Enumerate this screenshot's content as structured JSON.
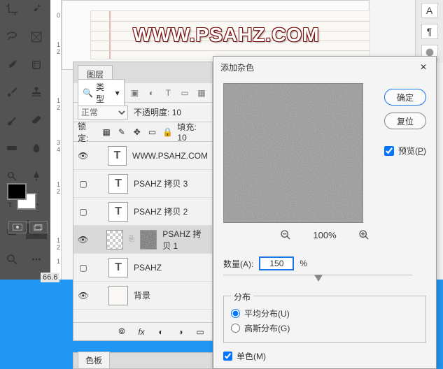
{
  "sidebar_icons": [
    "text-icon",
    "paragraph-icon",
    "3d-icon"
  ],
  "ruler_ticks": [
    "0",
    "1",
    "2",
    "1",
    "2",
    "3",
    "4",
    "1",
    "2",
    "1",
    "2",
    "1"
  ],
  "canvas": {
    "logo_text": "WWW.PSAHZ.COM"
  },
  "zoom_label": "66.6",
  "layers_panel": {
    "tab": "图层",
    "filter_label": "类型",
    "filter_icons": [
      "image-icon",
      "adjust-icon",
      "text-icon",
      "shape-icon",
      "smart-icon"
    ],
    "blend_mode": "正常",
    "opacity_label": "不透明度:",
    "opacity_value": "10",
    "lock_label": "锁定:",
    "fill_label": "填充:",
    "fill_value": "10",
    "layers": [
      {
        "visible": true,
        "thumb": "T",
        "name": "WWW.PSAHZ.COM"
      },
      {
        "visible": false,
        "thumb": "T",
        "name": "PSAHZ 拷贝 3"
      },
      {
        "visible": false,
        "thumb": "T",
        "name": "PSAHZ 拷贝 2"
      },
      {
        "visible": true,
        "thumb": "noise",
        "name": "PSAHZ 拷贝 1",
        "selected": true,
        "linked": true
      },
      {
        "visible": false,
        "thumb": "T",
        "name": "PSAHZ"
      },
      {
        "visible": true,
        "thumb": "blank",
        "name": "背景"
      }
    ],
    "footer_icons": [
      "link-icon",
      "fx-icon",
      "mask-icon",
      "adjust-icon",
      "folder-icon"
    ]
  },
  "swatch_panel": {
    "tab": "色板"
  },
  "dialog": {
    "title": "添加杂色",
    "ok": "确定",
    "reset": "复位",
    "preview_chk": "预览",
    "preview_key": "P",
    "zoom_value": "100%",
    "amount_label": "数量",
    "amount_key": "A",
    "amount_value": "150",
    "amount_unit": "%",
    "dist_legend": "分布",
    "dist_uniform": "平均分布",
    "dist_uniform_key": "U",
    "dist_gauss": "高斯分布",
    "dist_gauss_key": "G",
    "mono": "单色",
    "mono_key": "M"
  }
}
